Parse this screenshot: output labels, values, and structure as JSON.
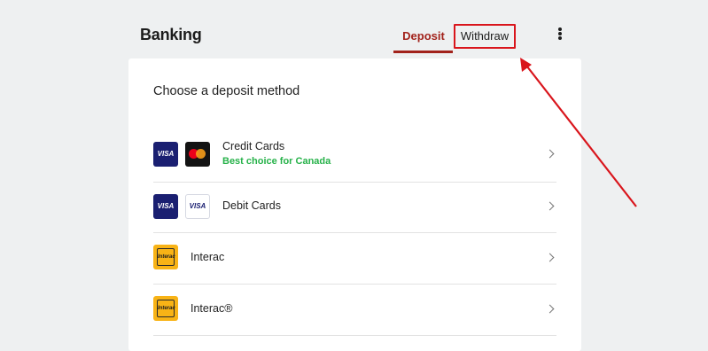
{
  "header": {
    "title": "Banking",
    "tabs": {
      "deposit": "Deposit",
      "withdraw": "Withdraw"
    },
    "active_tab": "Deposit",
    "menu_icon": "more-vertical-icon"
  },
  "main": {
    "section_title": "Choose a deposit method",
    "methods": [
      {
        "name": "Credit Cards",
        "subtitle": "Best choice for Canada",
        "logos": [
          "visa",
          "mastercard"
        ]
      },
      {
        "name": "Debit Cards",
        "logos": [
          "visa",
          "visa-debit"
        ]
      },
      {
        "name": "Interac",
        "logos": [
          "interac"
        ]
      },
      {
        "name": "Interac®",
        "logos": [
          "interac"
        ]
      }
    ]
  },
  "logo_text": {
    "visa": "VISA",
    "interac": "Interac"
  },
  "annotation": {
    "highlight_target": "Withdraw",
    "color": "#d9151c"
  },
  "colors": {
    "accent": "#a2231c",
    "highlight": "#d9151c",
    "success_text": "#27b24a",
    "background": "#eef0f1"
  }
}
